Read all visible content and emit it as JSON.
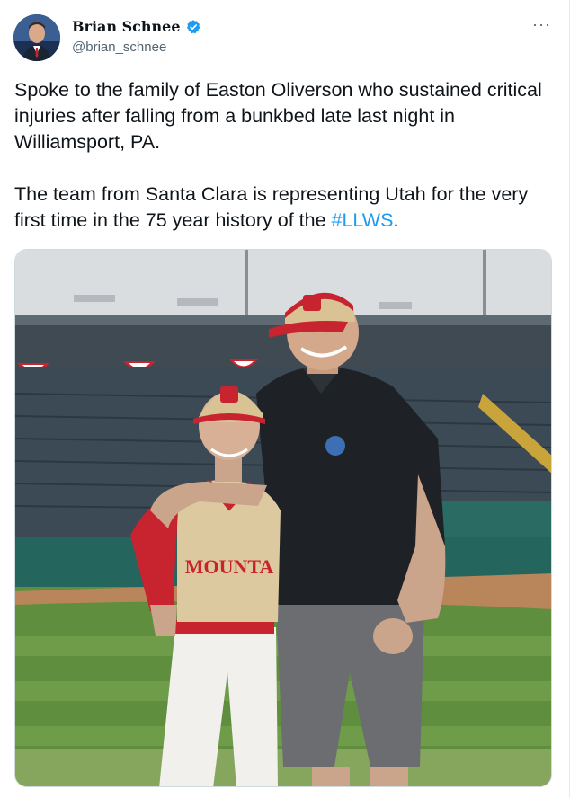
{
  "author": {
    "display_name": "Brian Schnee",
    "handle": "@brian_schnee",
    "verified": true,
    "avatar_icon": "profile-photo"
  },
  "more_menu": {
    "label": "···",
    "icon": "more-horizontal-icon"
  },
  "tweet": {
    "paragraph_1": "Spoke to the family of Easton Oliverson who sustained critical injuries after falling from a bunkbed late last night in Williamsport, PA.",
    "paragraph_2_text": "The team from Santa Clara is representing Utah for the very first time in the 75 year history of the ",
    "hashtag": "#LLWS",
    "paragraph_2_end": "."
  },
  "photo": {
    "jersey_text": "MOUNTA",
    "colors": {
      "sky": "#d9dde0",
      "grass": "#5f8f3e",
      "jersey": "#dcc9a0",
      "accent_red": "#c8242f",
      "polo": "#1e2226",
      "shorts": "#6b6d70"
    }
  },
  "colors": {
    "link": "#1d9bf0",
    "text": "#0f1419",
    "secondary": "#536471",
    "verified_badge": "#1d9bf0"
  }
}
